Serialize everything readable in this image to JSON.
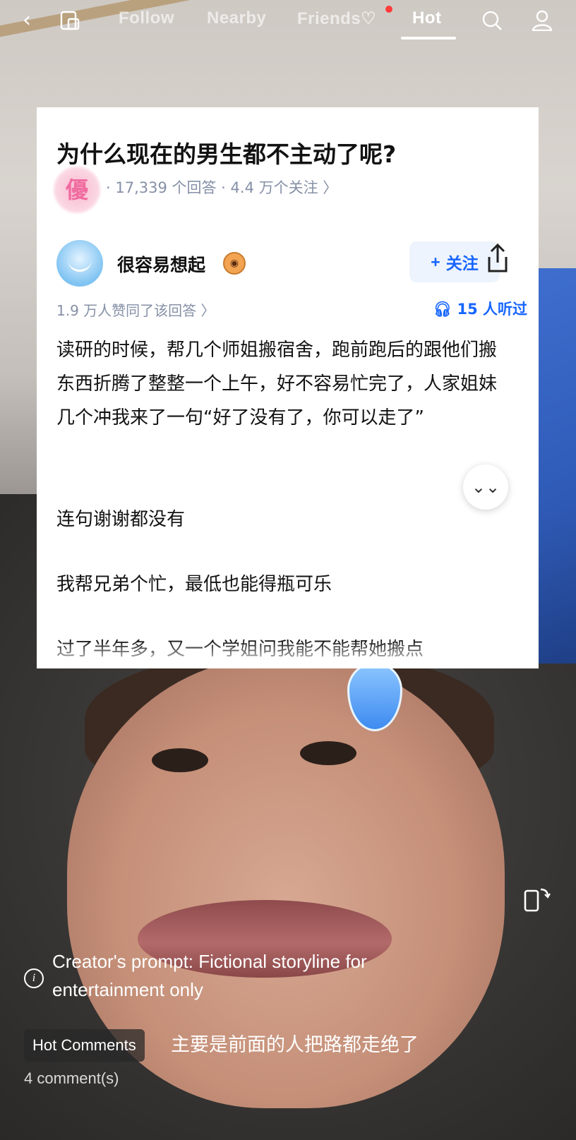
{
  "nav": {
    "back_icon": "chevron-left-icon",
    "screen_icon": "screen-icon",
    "tabs": [
      {
        "label": "Follow",
        "active": false
      },
      {
        "label": "Nearby",
        "active": false
      },
      {
        "label": "Friends♡",
        "active": false
      },
      {
        "label": "Hot",
        "active": true
      }
    ],
    "search_icon": "search-icon",
    "profile_icon": "profile-icon"
  },
  "card": {
    "question_title": "为什么现在的男生都不主动了呢?",
    "question_meta": "· 17,339 个回答 · 4.4 万个关注 〉",
    "author_name": "很容易想起",
    "follow_label": "关注",
    "follow_plus": "+",
    "approval_text": "1.9 万人赞同了该回答 〉",
    "listen_text": "15 人听过",
    "paragraphs": [
      "读研的时候，帮几个师姐搬宿舍，跑前跑后的跟他们搬东西折腾了整整一个上午，好不容易忙完了，人家姐妹几个冲我来了一句“好了没有了，你可以走了”",
      "连句谢谢都没有",
      "我帮兄弟个忙，最低也能得瓶可乐",
      "过了半年多，又一个学姐问我能不能帮她搬点"
    ],
    "stamp_char": "優",
    "expand_icon": "double-chevron-down-icon"
  },
  "notice": {
    "text": "Creator's prompt: Fictional storyline for entertainment only"
  },
  "comments": {
    "tag_label": "Hot Comments",
    "top_comment": "主要是前面的人把路都走绝了",
    "count_label": "4 comment(s)"
  },
  "colors": {
    "accent_blue": "#1766ff",
    "meta_gray": "#8590a6",
    "red_dot": "#ff3b3b"
  }
}
